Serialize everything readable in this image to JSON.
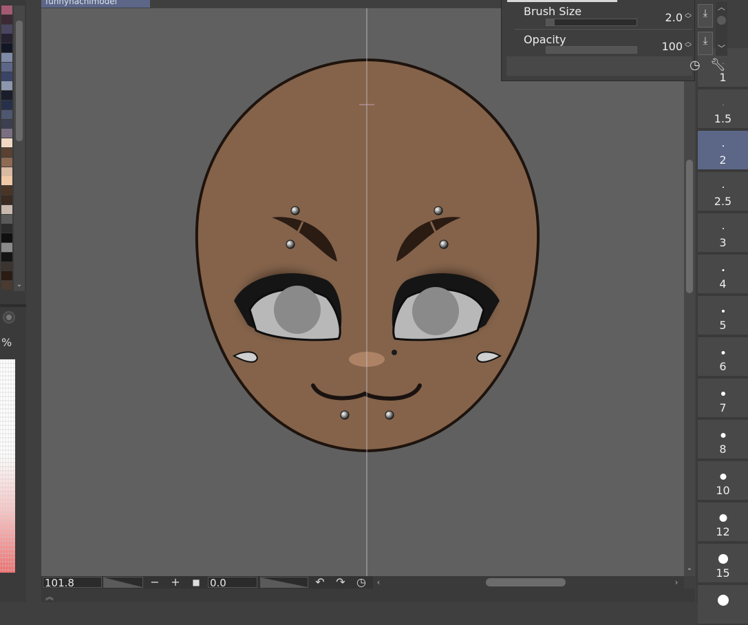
{
  "canvas": {
    "tab_title": "funnyhachimodel",
    "zoom": "101.8",
    "rotation": "0.0"
  },
  "left_panel": {
    "percent_symbol": "%",
    "swatch_colors": [
      "#a35a72",
      "#3b2a33",
      "#4a4660",
      "#262231",
      "#131725",
      "#7e8aa6",
      "#5c6788",
      "#3a4466",
      "#8c96ad",
      "#1a1d2a",
      "#27304a",
      "#4e5770",
      "#3c3f4f",
      "#7a6f80",
      "#f3d9c3",
      "#5a4131",
      "#8e6a53",
      "#d9b9a1",
      "#f0c8a6",
      "#4a3425",
      "#3a2a22",
      "#c9b8ad",
      "#5a5a5a",
      "#2d2d2d",
      "#101010",
      "#8a8a8a",
      "#141414",
      "#3a3330",
      "#2a1b13",
      "#4a3a30"
    ]
  },
  "property_panel": {
    "brush_size_label": "Brush Size",
    "brush_size_value": "2.0",
    "brush_size_fill": 0.3,
    "opacity_label": "Opacity",
    "opacity_value": "100",
    "opacity_fill": 1.0
  },
  "brush_sizes": [
    {
      "label": "1",
      "dot": 1
    },
    {
      "label": "1.5",
      "dot": 1
    },
    {
      "label": "2",
      "dot": 2,
      "selected": true
    },
    {
      "label": "2.5",
      "dot": 2
    },
    {
      "label": "3",
      "dot": 2
    },
    {
      "label": "4",
      "dot": 3
    },
    {
      "label": "5",
      "dot": 4
    },
    {
      "label": "6",
      "dot": 5
    },
    {
      "label": "7",
      "dot": 6
    },
    {
      "label": "8",
      "dot": 7
    },
    {
      "label": "10",
      "dot": 9
    },
    {
      "label": "12",
      "dot": 11
    },
    {
      "label": "15",
      "dot": 14
    },
    {
      "label": "",
      "dot": 16
    }
  ],
  "colors": {
    "skin": "#84634a",
    "outline": "#1e130d",
    "canvas_bg": "#606060",
    "selection": "#5c6788"
  },
  "icons": [
    "zoom-out-icon",
    "zoom-in-icon",
    "fit-icon",
    "rotate-left-icon",
    "rotate-right-icon",
    "rotate-reset-icon",
    "download-icon",
    "wrench-icon",
    "dial-icon"
  ]
}
